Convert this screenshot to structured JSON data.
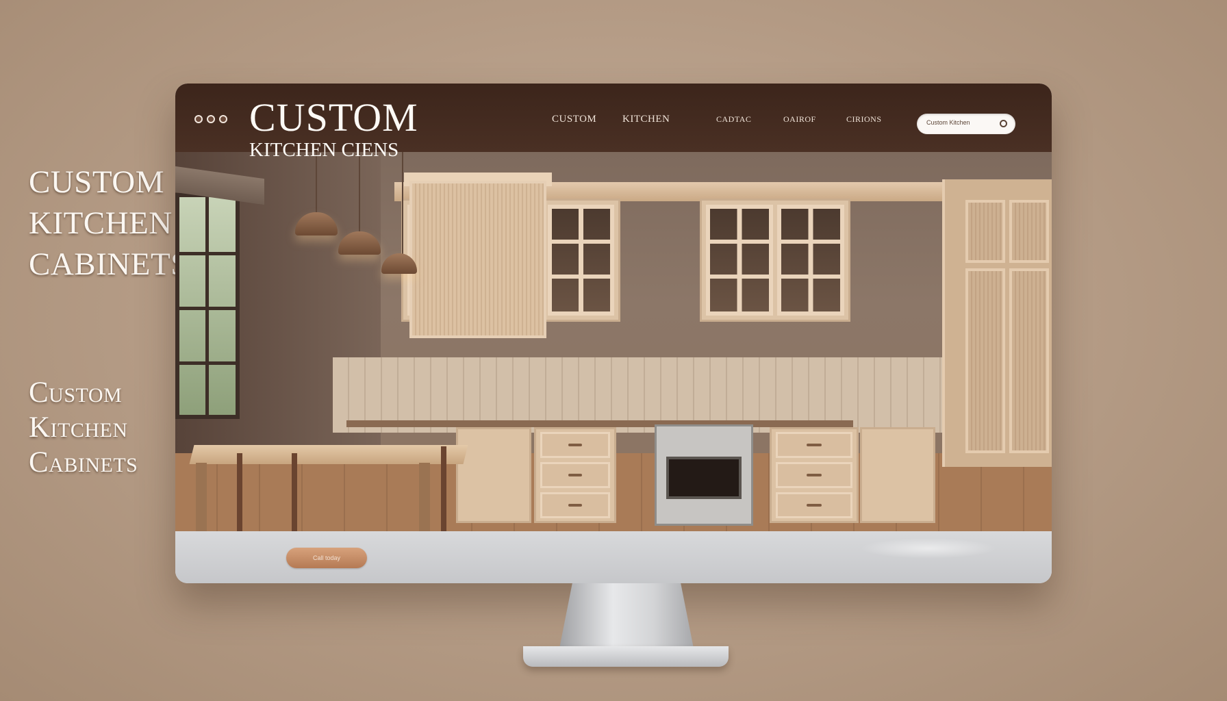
{
  "wall_text": {
    "heading_1": [
      "CUSTOM",
      "KITCHEN",
      "CABINETS"
    ],
    "heading_2": [
      "Custom",
      "Kitchen",
      "Cabinets"
    ]
  },
  "site": {
    "window_controls": [
      "dot",
      "dot",
      "dot"
    ],
    "brand_main": "CUSTOM",
    "brand_sub": "KITCHEN CIENS",
    "nav": {
      "item_1": "CUSTOM",
      "item_2": "KITCHEN",
      "item_3": "CADTAC",
      "item_4": "OAIROF",
      "item_5": "CIRIONS"
    },
    "search": {
      "value": "Custom Kitchen",
      "icon": "search-icon"
    },
    "chin_button": "Call today"
  },
  "colors": {
    "header": "#3c251b",
    "wall": "#b49b85",
    "cabinet_wood": "#dcc3a6"
  }
}
